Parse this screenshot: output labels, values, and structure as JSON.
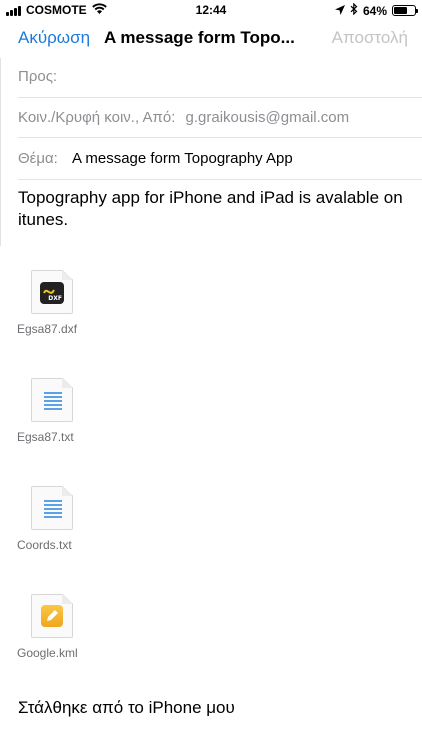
{
  "status_bar": {
    "carrier": "COSMOTE",
    "time": "12:44",
    "battery_percent": 64,
    "battery_label": "64%",
    "icons": [
      "signal-icon",
      "wifi-icon",
      "location-arrow-icon",
      "bluetooth-icon",
      "battery-icon"
    ]
  },
  "nav": {
    "cancel_label": "Ακύρωση",
    "title": "A message form Topo...",
    "send_label": "Αποστολή"
  },
  "fields": {
    "to_label": "Προς:",
    "to_value": "",
    "cc_label": "Κοιν./Κρυφή κοιν., Από:",
    "cc_value": "g.graikousis@gmail.com",
    "subject_label": "Θέμα:",
    "subject_value": "A message form Topography App"
  },
  "body_text": "Topography app for iPhone and iPad is avalable on itunes.",
  "attachments": [
    {
      "name": "Egsa87.dxf",
      "icon": "dxf-file-icon"
    },
    {
      "name": "Egsa87.txt",
      "icon": "text-file-icon"
    },
    {
      "name": "Coords.txt",
      "icon": "text-file-icon"
    },
    {
      "name": "Google.kml",
      "icon": "kml-file-icon"
    }
  ],
  "dxf_badge_text": "DXF",
  "signature": "Στάλθηκε από το iPhone μου",
  "colors": {
    "accent": "#1e7ad8",
    "disabled": "#c4c4c4",
    "secondary_text": "#8e8e93",
    "separator": "#e4e4e4"
  }
}
